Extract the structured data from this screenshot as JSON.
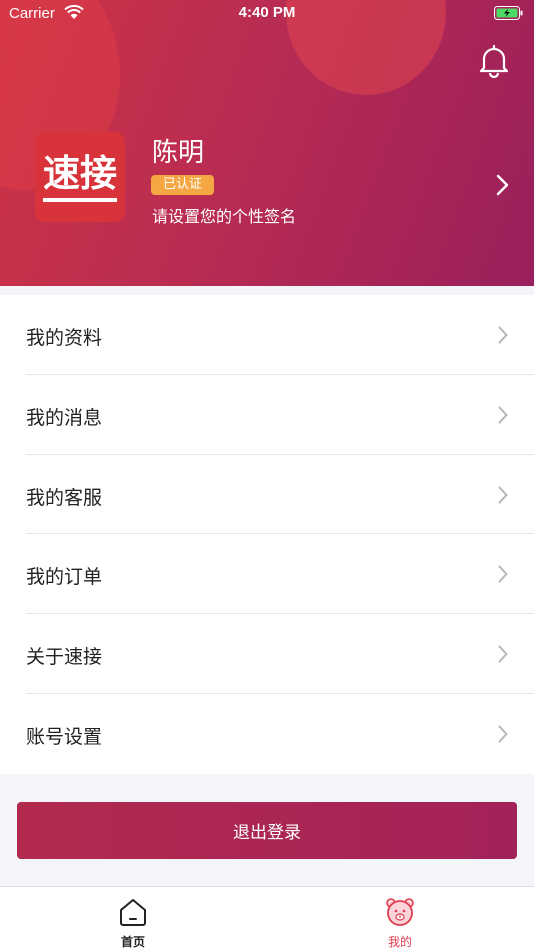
{
  "status_bar": {
    "carrier": "Carrier",
    "time": "4:40 PM"
  },
  "profile": {
    "avatar_text": "速接",
    "name": "陈明",
    "verified_badge": "已认证",
    "signature": "请设置您的个性签名"
  },
  "menu": {
    "items": [
      {
        "label": "我的资料"
      },
      {
        "label": "我的消息"
      },
      {
        "label": "我的客服"
      },
      {
        "label": "我的订单"
      },
      {
        "label": "关于速接"
      },
      {
        "label": "账号设置"
      }
    ]
  },
  "logout_label": "退出登录",
  "tabbar": {
    "tabs": [
      {
        "label": "首页",
        "icon": "home-icon",
        "active": false
      },
      {
        "label": "我的",
        "icon": "bear-profile-icon",
        "active": true
      }
    ]
  },
  "colors": {
    "header_start": "#cf3346",
    "header_end": "#9a1f5c",
    "badge": "#f4a742",
    "active_tab": "#e03a4f"
  }
}
